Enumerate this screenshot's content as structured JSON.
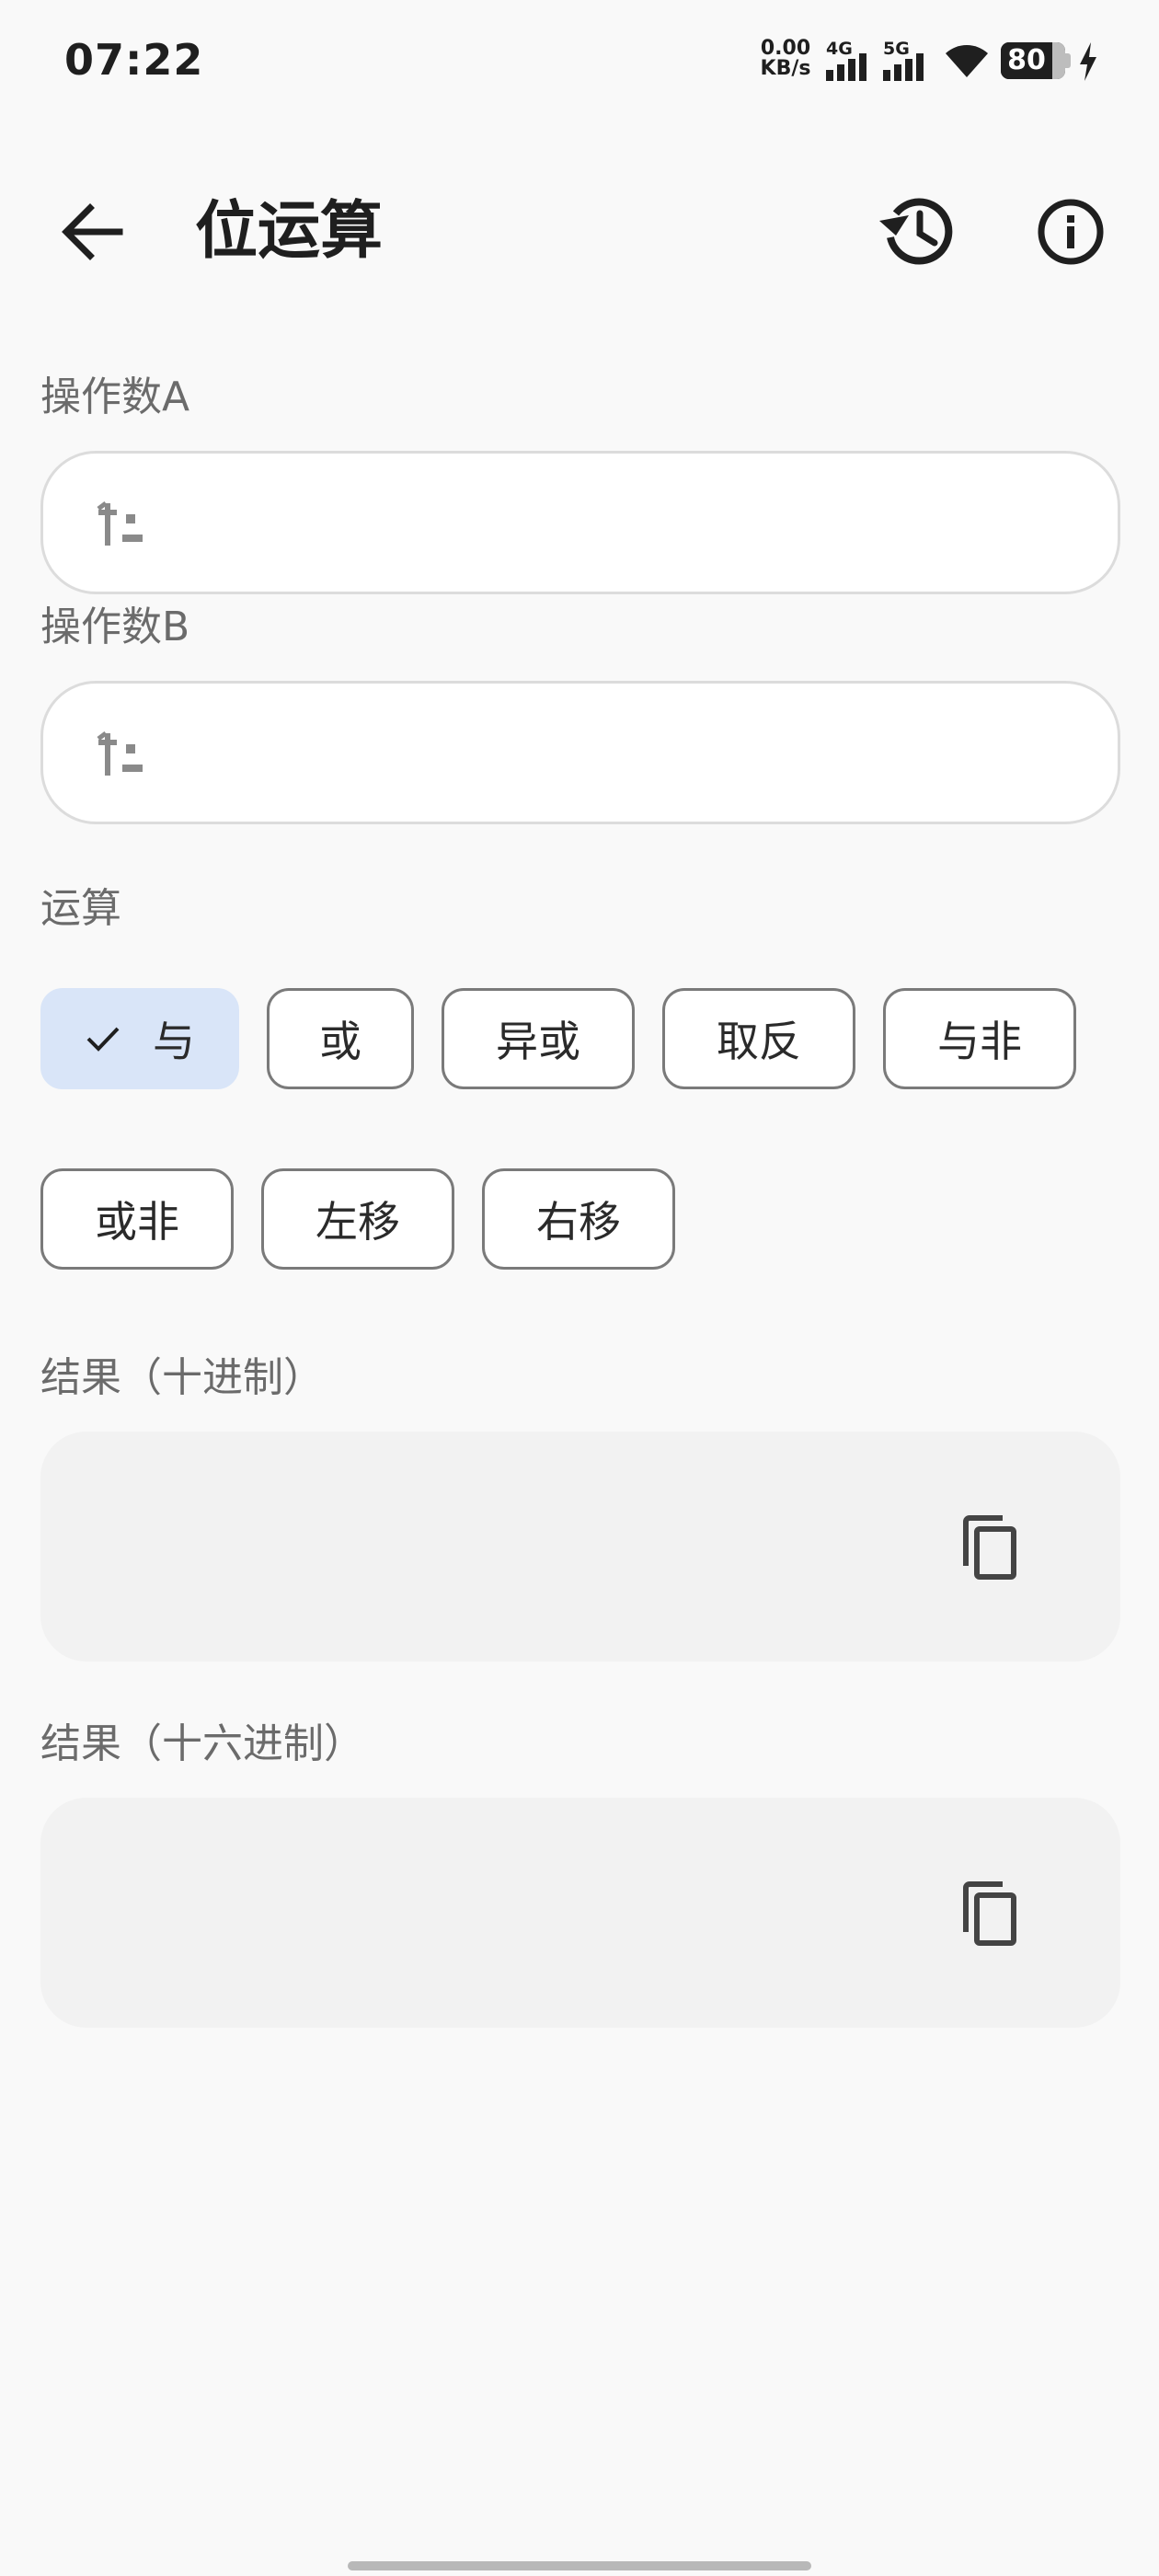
{
  "status_bar": {
    "time": "07:22",
    "net_speed_value": "0.00",
    "net_speed_unit": "KB/s",
    "sim1_type": "4G",
    "sim2_type": "5G",
    "battery_level": "80",
    "charging": true
  },
  "app_bar": {
    "title": "位运算",
    "back_icon": "arrow-back-icon",
    "history_icon": "history-icon",
    "info_icon": "info-icon"
  },
  "operand_a": {
    "label": "操作数A",
    "value": "",
    "icon": "plus-minus-icon"
  },
  "operand_b": {
    "label": "操作数B",
    "value": "",
    "icon": "plus-minus-icon"
  },
  "operation": {
    "label": "运算",
    "selected": "与",
    "options_row1": [
      "与",
      "或",
      "异或",
      "取反",
      "与非"
    ],
    "options_row2": [
      "或非",
      "左移",
      "右移"
    ]
  },
  "result_decimal": {
    "label": "结果（十进制）",
    "value": "",
    "copy_icon": "copy-icon"
  },
  "result_hex": {
    "label": "结果（十六进制）",
    "value": "",
    "copy_icon": "copy-icon"
  },
  "colors": {
    "background": "#f9f9f9",
    "selected_chip": "#d9e5f8",
    "label_gray": "#6b6b6b",
    "result_box": "#f2f2f2"
  }
}
